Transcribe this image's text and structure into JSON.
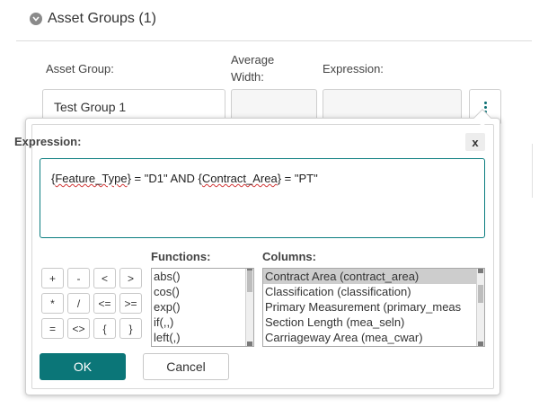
{
  "section": {
    "title": "Asset Groups (1)",
    "icon": "chevron-down-circle-icon"
  },
  "columns": {
    "asset_group": "Asset Group:",
    "average_width_line1": "Average",
    "average_width_line2": "Width:",
    "expression": "Expression:"
  },
  "row": {
    "asset_group_value": "Test Group 1",
    "average_width_value": "",
    "expression_value": ""
  },
  "popup": {
    "title": "Expression:",
    "close_label": "x",
    "expression_parts": [
      "{",
      "Feature_Type",
      "} = \"D1\" AND {",
      "Contract_Area",
      "} = \"PT\""
    ],
    "operators": [
      "+",
      "-",
      "<",
      ">",
      "*",
      "/",
      "<=",
      ">=",
      "=",
      "<>",
      "{",
      "}"
    ],
    "functions_label": "Functions:",
    "functions": [
      "abs()",
      "cos()",
      "exp()",
      "if(,,)",
      "left(,)"
    ],
    "columns_label": "Columns:",
    "columns_list": [
      "Contract Area (contract_area)",
      "Classification (classification)",
      "Primary Measurement (primary_meas",
      "Section Length (mea_seln)",
      "Carriageway Area (mea_cwar)"
    ],
    "columns_selected_index": 0,
    "ok_label": "OK",
    "cancel_label": "Cancel"
  },
  "colors": {
    "accent": "#0b7678",
    "focus_border": "#0b7d80"
  }
}
